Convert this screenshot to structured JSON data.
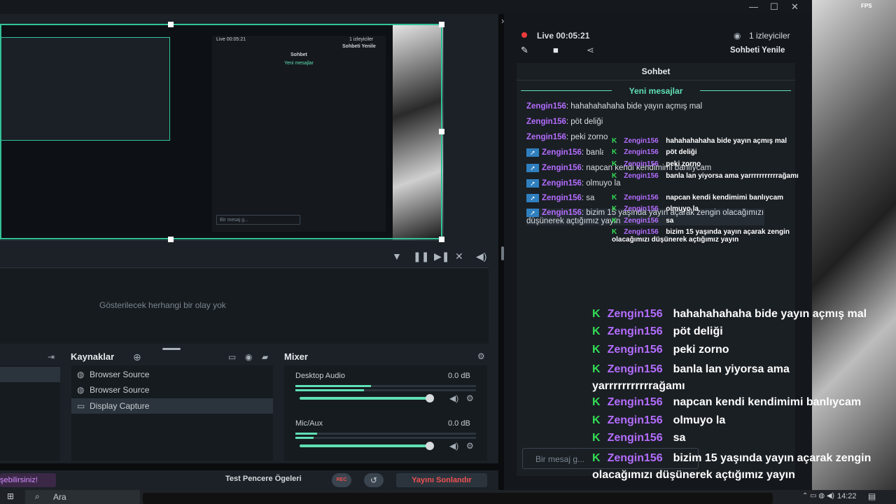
{
  "window": {
    "minimize": "—",
    "maximize": "☐",
    "close": "✕"
  },
  "corner": {
    "fps_label": "FPS"
  },
  "preview": {
    "inner_status": "Live 00:05:21",
    "inner_viewers": "1 izleyiciler",
    "inner_refresh": "Sohbeti Yenile",
    "inner_chat_title": "Sohbet",
    "inner_new": "Yeni mesajlar",
    "inner_input": "Bir mesaj g..."
  },
  "events": {
    "empty_text": "Gösterilecek herhangi bir olay yok"
  },
  "sources": {
    "title": "Kaynaklar",
    "items": [
      {
        "label": "Browser Source",
        "icon": "globe-icon",
        "selected": false
      },
      {
        "label": "Browser Source",
        "icon": "globe-icon",
        "selected": false
      },
      {
        "label": "Display Capture",
        "icon": "monitor-icon",
        "selected": true
      }
    ]
  },
  "mixer": {
    "title": "Mixer",
    "channels": [
      {
        "label": "Desktop Audio",
        "value": "0.0 dB",
        "level": 0.42,
        "volume": 0.94
      },
      {
        "label": "Mic/Aux",
        "value": "0.0 dB",
        "level": 0.12,
        "volume": 0.94
      }
    ]
  },
  "footer": {
    "discover": "şebilirsiniz!",
    "test": "Test Pencere Ögeleri",
    "rec": "REC",
    "end": "Yayını Sonlandır"
  },
  "chat": {
    "status": "Live 00:05:21",
    "viewers": "1 izleyiciler",
    "refresh": "Sohbeti Yenile",
    "title": "Sohbet",
    "new_messages": "Yeni mesajlar",
    "input_placeholder": "Bir mesaj g...",
    "messages": [
      {
        "user": "Zengin156",
        "text": ": hahahahahaha bide yayın açmış mal",
        "badge": false
      },
      {
        "user": "Zengin156",
        "text": ": pöt deliği",
        "badge": false
      },
      {
        "user": "Zengin156",
        "text": ": peki zorno",
        "badge": false
      },
      {
        "user": "Zengin156",
        "text": ": banla lan yiyorsa ama yarrrrrrrrrrağamı",
        "badge": true
      },
      {
        "user": "Zengin156",
        "text": ": napcan kendi kendimimi banlıycam",
        "badge": true
      },
      {
        "user": "Zengin156",
        "text": ": olmuyo la",
        "badge": true
      },
      {
        "user": "Zengin156",
        "text": ": sa",
        "badge": true
      },
      {
        "user": "Zengin156",
        "text": ": bizim 15 yaşında yayın açarak zengin olacağımızı düşünerek açtığımız yayın",
        "badge": true
      }
    ]
  },
  "overlay": {
    "messages": [
      {
        "user": "Zengin156",
        "text": "hahahahahaha bide yayın açmış mal"
      },
      {
        "user": "Zengin156",
        "text": "pöt deliği"
      },
      {
        "user": "Zengin156",
        "text": "peki zorno"
      },
      {
        "user": "Zengin156",
        "text": "banla lan yiyorsa ama yarrrrrrrrrrrağamı"
      },
      {
        "user": "Zengin156",
        "text": "napcan kendi kendimimi banlıycam"
      },
      {
        "user": "Zengin156",
        "text": "olmuyo la"
      },
      {
        "user": "Zengin156",
        "text": "sa"
      },
      {
        "user": "Zengin156",
        "text": "bizim 15 yaşında yayın açarak zengin olacağımızı düşünerek açtığımız yayın"
      }
    ]
  },
  "taskbar": {
    "search": "Ara",
    "time": "14:22"
  }
}
